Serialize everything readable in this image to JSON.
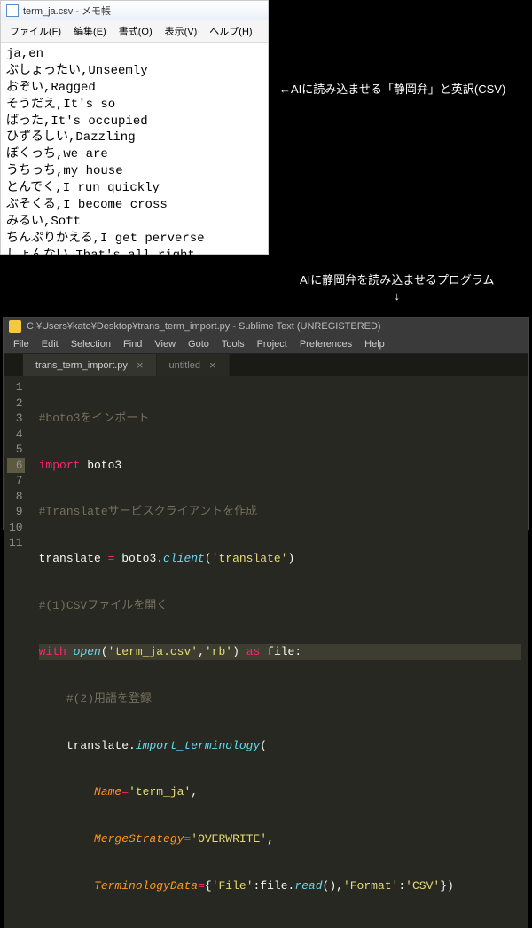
{
  "notepad": {
    "title": "term_ja.csv - メモ帳",
    "menu": {
      "file": "ファイル(F)",
      "edit": "編集(E)",
      "format": "書式(O)",
      "view": "表示(V)",
      "help": "ヘルプ(H)"
    },
    "content": "ja,en\nぶしょったい,Unseemly\nおぞい,Ragged\nそうだえ,It's so\nばった,It's occupied\nひずるしい,Dazzling\nぼくっち,we are\nうちっち,my house\nとんでく,I run quickly\nぶそくる,I become cross\nみるい,Soft\nちんぷりかえる,I get perverse\nしょんない,That's all right"
  },
  "annotation": {
    "label1": "←AIに読み込ませる「静岡弁」と英訳(CSV)",
    "label2": "AIに静岡弁を読み込ませるプログラム",
    "arrow": "↓"
  },
  "sublime": {
    "title": "C:¥Users¥kato¥Desktop¥trans_term_import.py - Sublime Text (UNREGISTERED)",
    "menu": {
      "file": "File",
      "edit": "Edit",
      "selection": "Selection",
      "find": "Find",
      "view": "View",
      "goto": "Goto",
      "tools": "Tools",
      "project": "Project",
      "preferences": "Preferences",
      "help": "Help"
    },
    "tabs": {
      "active": "trans_term_import.py",
      "close1": "×",
      "inactive": "untitled",
      "close2": "×"
    },
    "gutter": [
      "1",
      "2",
      "3",
      "4",
      "5",
      "6",
      "7",
      "8",
      "9",
      "10",
      "11"
    ],
    "code": {
      "l1_comment": "#boto3をインポート",
      "l2_kw": "import",
      "l2_mod": " boto3",
      "l3_comment": "#Translateサービスクライアントを作成",
      "l4_a": "translate ",
      "l4_eq": "=",
      "l4_b": " boto3.",
      "l4_fn": "client",
      "l4_c": "(",
      "l4_str": "'translate'",
      "l4_d": ")",
      "l5_comment": "#(1)CSVファイルを開く",
      "l6_with": "with",
      "l6_a": " ",
      "l6_fn": "open",
      "l6_b": "(",
      "l6_str": "'term_ja.csv'",
      "l6_c": ",",
      "l6_str2": "'rb'",
      "l6_d": ") ",
      "l6_as": "as",
      "l6_e": " file:",
      "l7_indent": "    ",
      "l7_comment": "#(2)用語を登録",
      "l8_indent": "    ",
      "l8_a": "translate.",
      "l8_fn": "import_terminology",
      "l8_b": "(",
      "l9_indent": "        ",
      "l9_param": "Name",
      "l9_eq": "=",
      "l9_str": "'term_ja'",
      "l9_c": ",",
      "l10_indent": "        ",
      "l10_param": "MergeStrategy",
      "l10_eq": "=",
      "l10_str": "'OVERWRITE'",
      "l10_c": ",",
      "l11_indent": "        ",
      "l11_param": "TerminologyData",
      "l11_eq": "=",
      "l11_a": "{",
      "l11_str1": "'File'",
      "l11_b": ":file.",
      "l11_fn": "read",
      "l11_c": "(),",
      "l11_str2": "'Format'",
      "l11_d": ":",
      "l11_str3": "'CSV'",
      "l11_e": "})"
    }
  }
}
